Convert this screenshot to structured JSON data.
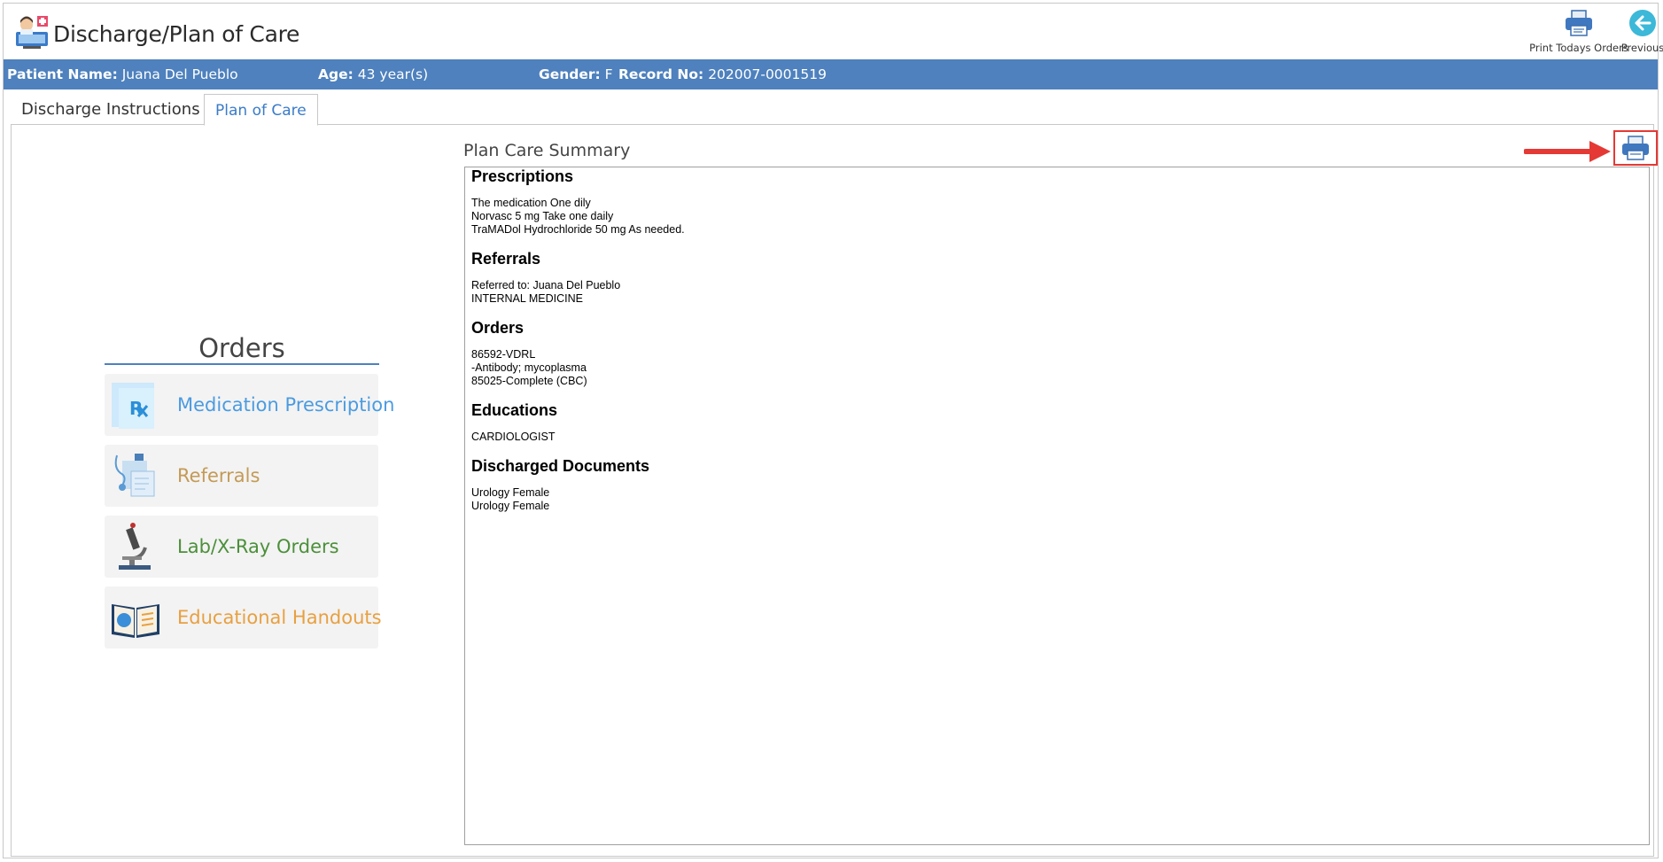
{
  "header": {
    "title": "Discharge/Plan of Care",
    "app_icon": "doctor-screen-icon",
    "print_orders_label": "Print Todays Orders",
    "previous_label": "Previous"
  },
  "patient": {
    "name_label": "Patient Name:",
    "name": "Juana Del Pueblo",
    "age_label": "Age:",
    "age": "43 year(s)",
    "gender_label": "Gender:",
    "gender": "F",
    "record_label": "Record No:",
    "record": "202007-0001519"
  },
  "tabs": [
    {
      "label": "Discharge Instructions",
      "active": false
    },
    {
      "label": "Plan of Care",
      "active": true
    }
  ],
  "orders": {
    "title": "Orders",
    "items": [
      {
        "label": "Medication Prescription",
        "color": "#4a9be0",
        "icon": "prescription-icon"
      },
      {
        "label": "Referrals",
        "color": "#c49a56",
        "icon": "referral-icon"
      },
      {
        "label": "Lab/X-Ray Orders",
        "color": "#4c8f3a",
        "icon": "microscope-icon"
      },
      {
        "label": "Educational Handouts",
        "color": "#e8a040",
        "icon": "book-icon"
      }
    ]
  },
  "summary": {
    "title": "Plan Care Summary",
    "sections": [
      {
        "title": "Prescriptions",
        "lines": [
          "The medication One dily",
          "Norvasc 5 mg Take one daily",
          "TraMADol Hydrochloride 50 mg As needed."
        ]
      },
      {
        "title": "Referrals",
        "lines": [
          "Referred to: Juana Del Pueblo",
          "INTERNAL MEDICINE"
        ]
      },
      {
        "title": "Orders",
        "lines": [
          "86592-VDRL",
          "-Antibody; mycoplasma",
          "85025-Complete (CBC)"
        ]
      },
      {
        "title": "Educations",
        "lines": [
          "CARDIOLOGIST"
        ]
      },
      {
        "title": "Discharged Documents",
        "lines": [
          "Urology Female",
          "Urology Female"
        ]
      }
    ]
  },
  "colors": {
    "accent": "#4e81bd",
    "highlight": "#e53935"
  }
}
